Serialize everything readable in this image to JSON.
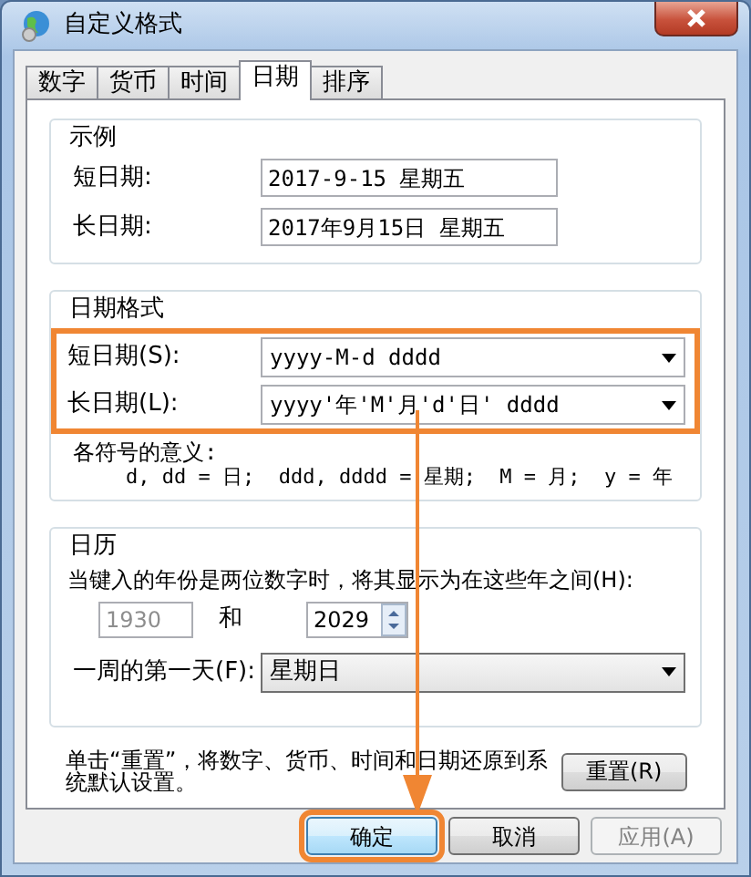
{
  "window": {
    "title": "自定义格式"
  },
  "tabs": [
    {
      "label": "数字",
      "selected": false
    },
    {
      "label": "货币",
      "selected": false
    },
    {
      "label": "时间",
      "selected": false
    },
    {
      "label": "日期",
      "selected": true
    },
    {
      "label": "排序",
      "selected": false
    }
  ],
  "sample": {
    "title": "示例",
    "rows": [
      {
        "label": "短日期:",
        "value": "2017-9-15 星期五"
      },
      {
        "label": "长日期:",
        "value": "2017年9月15日 星期五"
      }
    ]
  },
  "date_formats": {
    "title": "日期格式",
    "highlighted": true,
    "rows": [
      {
        "label": "短日期(S):",
        "value": "yyyy-M-d dddd"
      },
      {
        "label": "长日期(L):",
        "value": "yyyy'年'M'月'd'日' dddd"
      }
    ],
    "legend_title": "各符号的意义:",
    "legend": "d, dd = 日;  ddd, dddd = 星期;  M = 月;  y = 年"
  },
  "calendar": {
    "title": "日历",
    "two_digit_label": "当键入的年份是两位数字时，将其显示为在这些年之间(H):",
    "from_year": {
      "value": "1930",
      "disabled": true
    },
    "and": "和",
    "to_year": "2029",
    "first_day_label": "一周的第一天(F):",
    "first_day": "星期日"
  },
  "reset": {
    "text": "单击“重置”，将数字、货币、时间和日期还原到系统默认设置。",
    "button": "重置(R)"
  },
  "buttons": [
    {
      "label": "确定",
      "highlighted": true,
      "disabled": false
    },
    {
      "label": "取消",
      "highlighted": false,
      "disabled": false
    },
    {
      "label": "应用(A)",
      "highlighted": false,
      "disabled": true
    }
  ]
}
